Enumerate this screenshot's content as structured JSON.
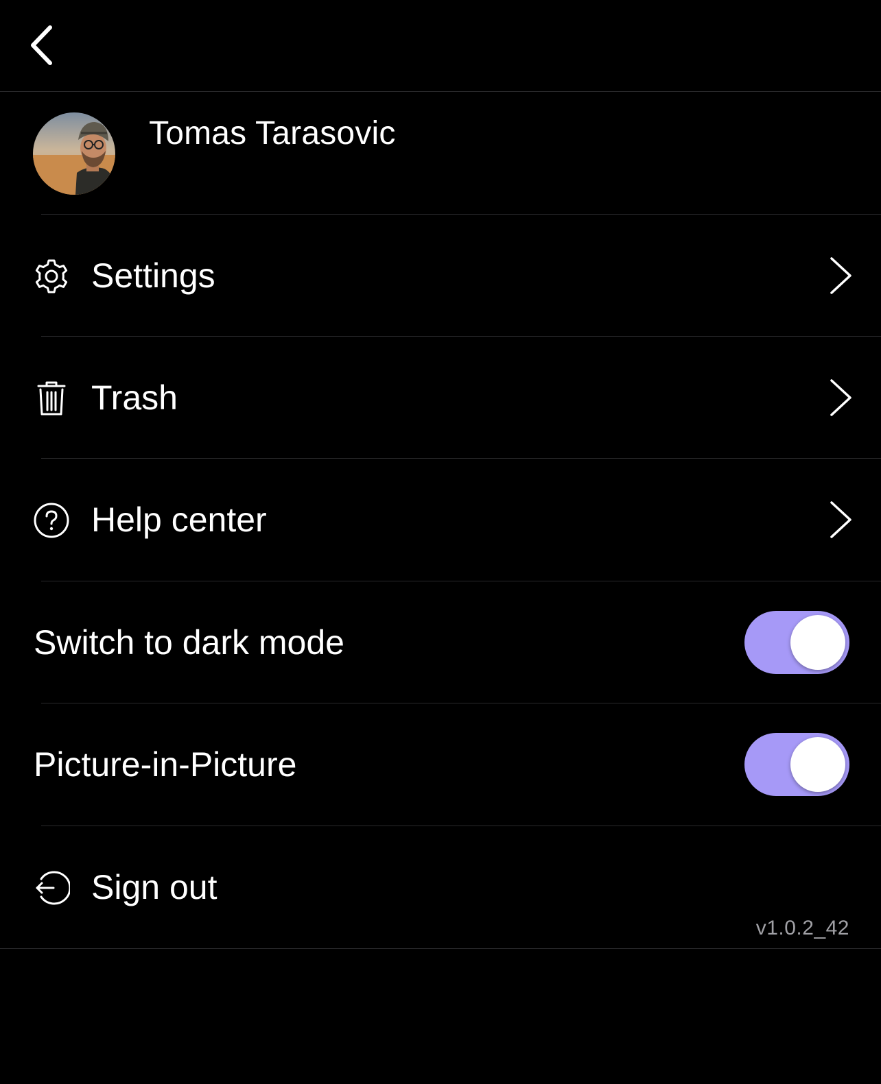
{
  "header": {
    "back_icon": "chevron-left-icon"
  },
  "profile": {
    "name": "Tomas Tarasovic"
  },
  "menu": {
    "items": [
      {
        "label": "Settings",
        "icon": "gear-icon"
      },
      {
        "label": "Trash",
        "icon": "trash-icon"
      },
      {
        "label": "Help center",
        "icon": "question-circle-icon"
      }
    ]
  },
  "toggles": [
    {
      "label": "Switch to dark mode",
      "on": true
    },
    {
      "label": "Picture-in-Picture",
      "on": true
    }
  ],
  "sign_out": {
    "label": "Sign out",
    "icon": "sign-out-icon"
  },
  "version": "v1.0.2_42",
  "colors": {
    "background": "#000000",
    "toggle_on": "#a699f7",
    "divider": "#2a2a2c",
    "version_text": "#a0a0a5"
  }
}
